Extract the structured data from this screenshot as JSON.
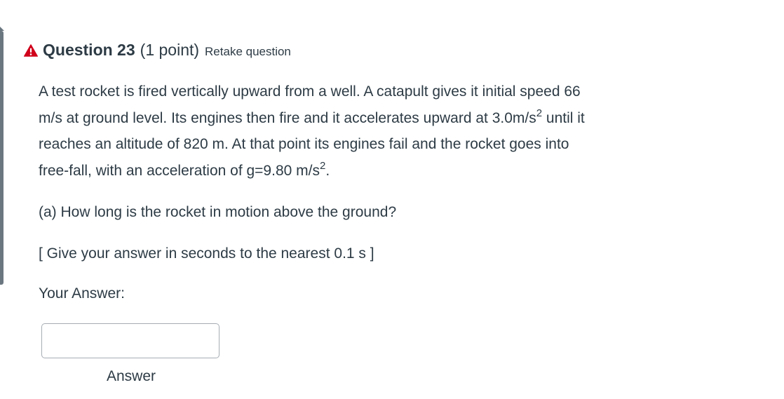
{
  "question": {
    "title": "Question 23",
    "points": "(1 point)",
    "retake_label": "Retake question",
    "warning_icon": "warning-triangle-icon",
    "warning_color": "#d0021b"
  },
  "body": {
    "line1": "A test rocket is fired vertically upward from a well. A catapult gives it initial speed 66",
    "line2_pre": "m/s at ground level. Its engines then fire and it accelerates upward at 3.0m/s",
    "line2_sup": "2",
    "line2_post": " until it",
    "line3": "reaches an altitude of 820 m. At that point its engines fail and the rocket goes into",
    "line4_pre": "free-fall, with an acceleration of g=9.80 m/s",
    "line4_sup": "2",
    "line4_post": "."
  },
  "part_a": "(a) How long is the rocket in motion above the ground?",
  "hint": "[ Give your answer in seconds to the nearest 0.1 s ]",
  "your_answer_label": "Your Answer:",
  "answer_input": {
    "value": "",
    "placeholder": ""
  },
  "answer_caption": "Answer"
}
